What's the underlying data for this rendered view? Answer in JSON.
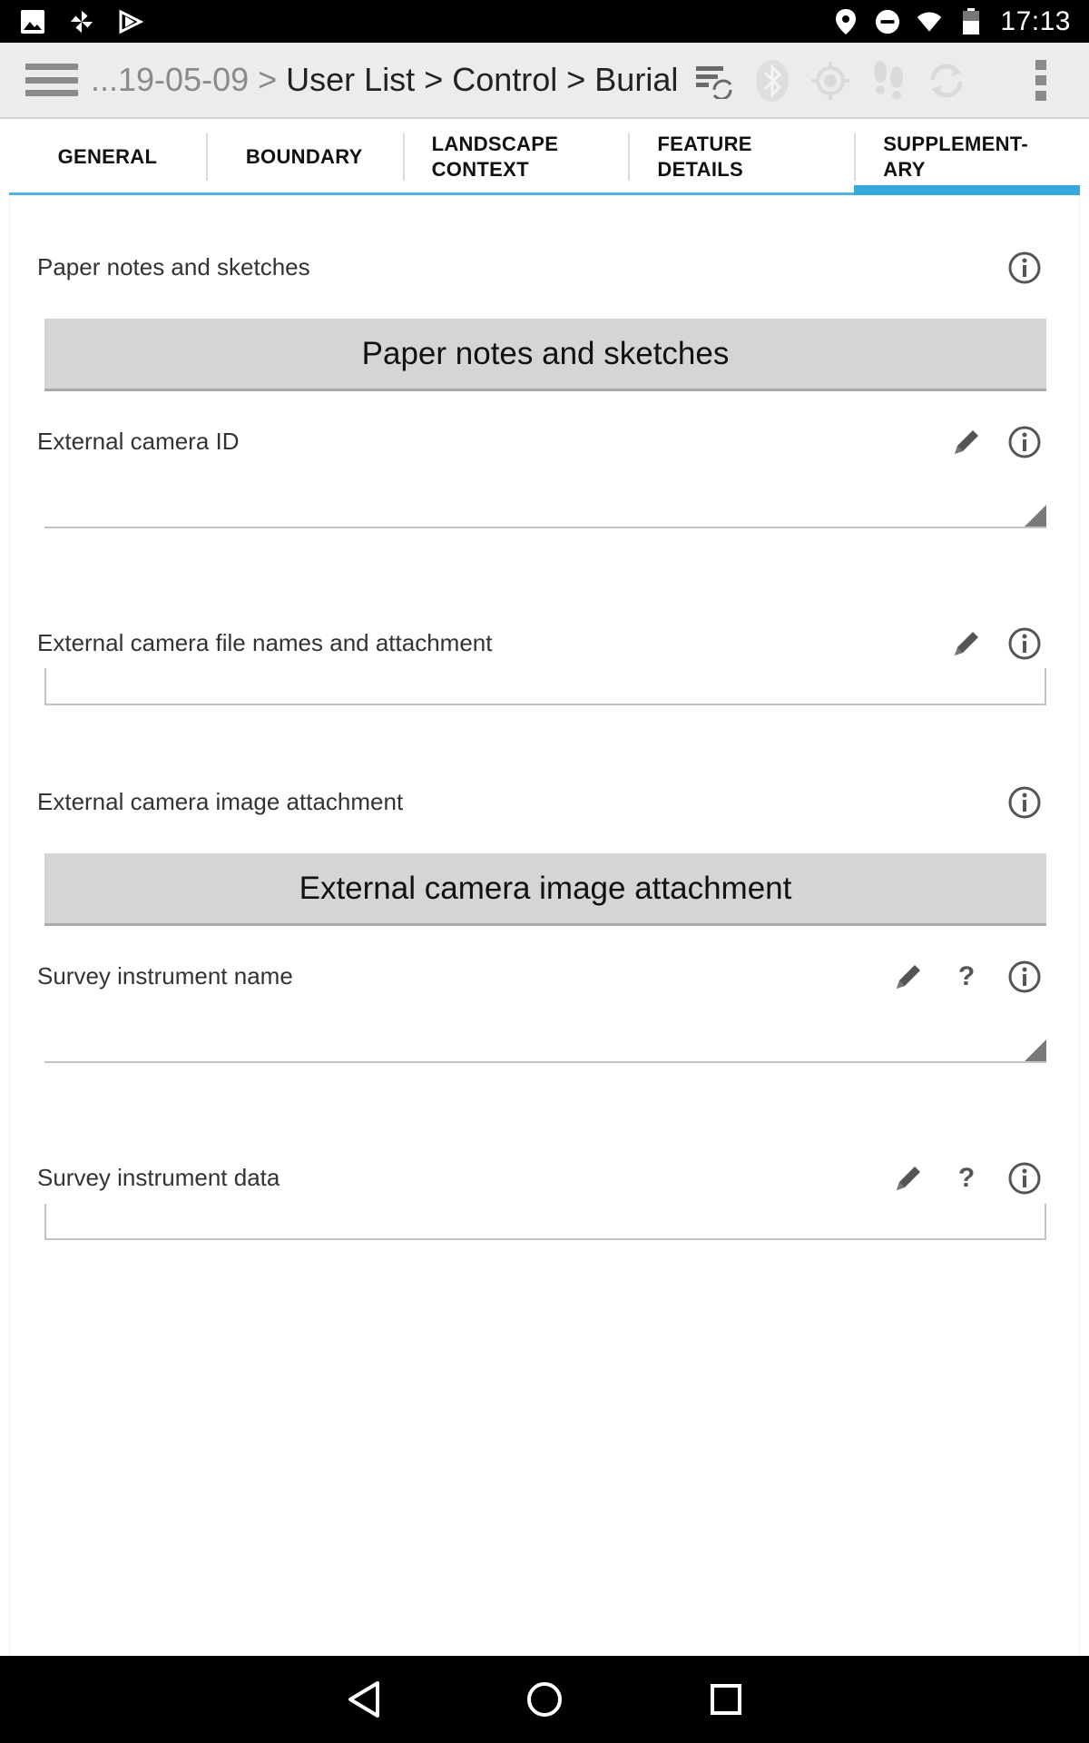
{
  "status_bar": {
    "time": "17:13",
    "left_icons": [
      "image-icon",
      "pinwheel-icon",
      "play-store-icon"
    ],
    "right_icons": [
      "location-icon",
      "do-not-disturb-icon",
      "wifi-icon",
      "battery-icon"
    ]
  },
  "action_bar": {
    "breadcrumb_prefix": "...19-05-09 >",
    "breadcrumb_current": "User List > Control > Burial",
    "icons": [
      "sync-list-icon",
      "bluetooth-icon",
      "gps-icon",
      "footsteps-icon",
      "refresh-icon",
      "overflow-menu-icon"
    ]
  },
  "tabs": [
    {
      "lines": [
        "GENERAL"
      ],
      "active": false
    },
    {
      "lines": [
        "BOUNDARY"
      ],
      "active": false
    },
    {
      "lines": [
        "LANDSCAPE",
        "CONTEXT"
      ],
      "active": false
    },
    {
      "lines": [
        "FEATURE",
        "DETAILS"
      ],
      "active": false
    },
    {
      "lines": [
        "SUPPLEMENT-",
        "ARY"
      ],
      "active": true
    }
  ],
  "fields": {
    "paper_notes": {
      "label": "Paper notes and sketches",
      "button": "Paper notes and sketches"
    },
    "camera_id": {
      "label": "External camera ID",
      "value": ""
    },
    "camera_files": {
      "label": "External camera file names and attachment",
      "value": ""
    },
    "camera_image": {
      "label": "External camera image attachment",
      "button": "External camera image attachment"
    },
    "instrument_name": {
      "label": "Survey instrument name",
      "value": ""
    },
    "instrument_data": {
      "label": "Survey instrument data",
      "value": ""
    }
  },
  "nav_bar": {
    "icons": [
      "back-icon",
      "home-icon",
      "recents-icon"
    ]
  },
  "colors": {
    "tab_indicator": "#36a9dc",
    "tab_underline": "#4fb3dc",
    "action_bar_bg": "#ececec",
    "button_bg": "#d5d5d5"
  }
}
